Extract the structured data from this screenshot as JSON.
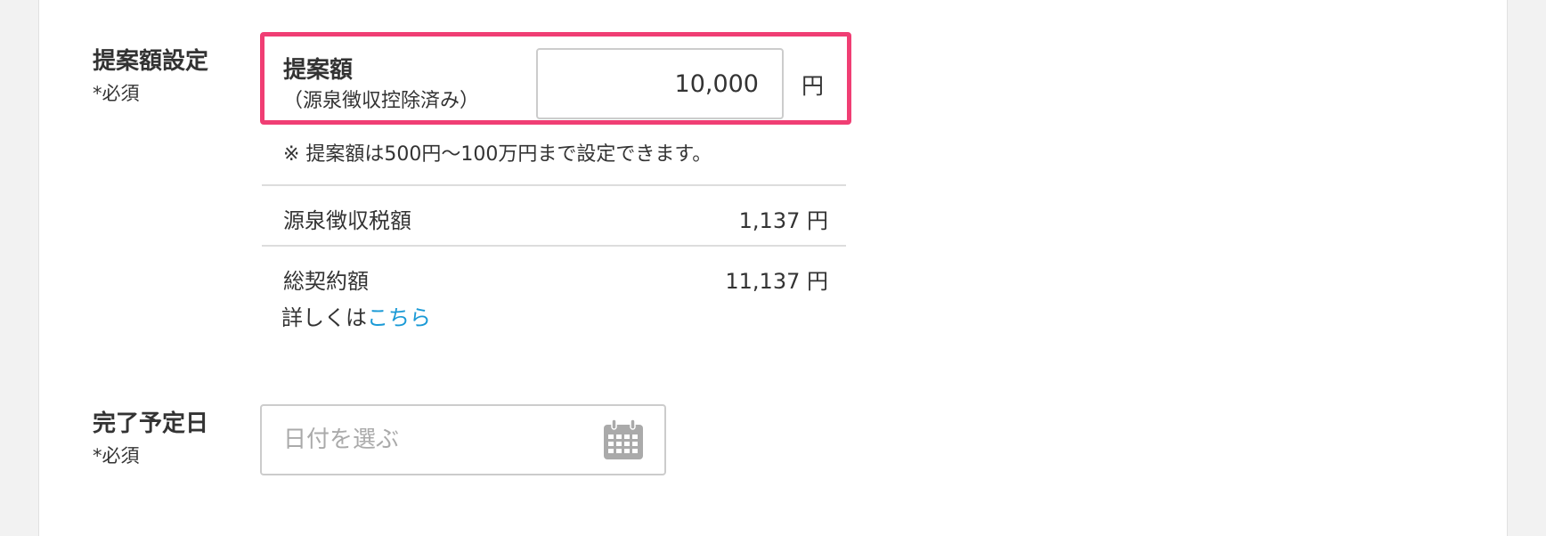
{
  "proposal_section": {
    "title": "提案額設定",
    "required": "*必須",
    "amount_label": "提案額",
    "amount_sublabel": "（源泉徴収控除済み）",
    "amount_value": "10,000",
    "amount_unit": "円",
    "note": "※ 提案額は500円〜100万円まで設定できます。",
    "withholding_label": "源泉徴収税額",
    "withholding_value": "1,137 円",
    "total_label": "総契約額",
    "total_value": "11,137 円",
    "details_prefix": "詳しくは",
    "details_link": "こちら"
  },
  "completion_section": {
    "title": "完了予定日",
    "required": "*必須",
    "date_placeholder": "日付を選ぶ",
    "icon": "calendar-icon"
  },
  "colors": {
    "highlight_border": "#f03e74",
    "link": "#1a9ad6",
    "calendar_icon": "#aaaaaa"
  }
}
